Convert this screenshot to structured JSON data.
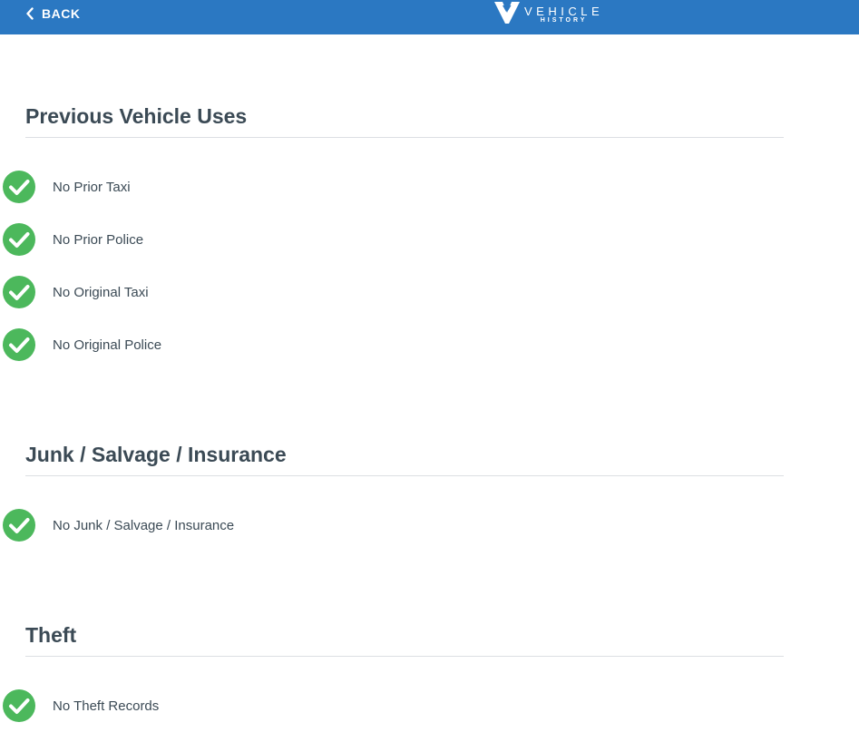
{
  "header": {
    "back_label": "BACK",
    "logo_word": "VEHICLE",
    "logo_sub": "HISTORY",
    "logo_icon": "vehicle-history-logo-icon",
    "back_icon": "chevron-left-icon"
  },
  "colors": {
    "header_bg": "#2b78c2",
    "check_green": "#4cb85c",
    "text": "#3b4a55",
    "rule": "#dcdfe3"
  },
  "sections": [
    {
      "title": "Previous Vehicle Uses",
      "items": [
        {
          "label": "No Prior Taxi",
          "icon": "check-circle-icon"
        },
        {
          "label": "No Prior Police",
          "icon": "check-circle-icon"
        },
        {
          "label": "No Original Taxi",
          "icon": "check-circle-icon"
        },
        {
          "label": "No Original Police",
          "icon": "check-circle-icon"
        }
      ]
    },
    {
      "title": "Junk / Salvage / Insurance",
      "items": [
        {
          "label": "No Junk / Salvage / Insurance",
          "icon": "check-circle-icon"
        }
      ]
    },
    {
      "title": "Theft",
      "items": [
        {
          "label": "No Theft Records",
          "icon": "check-circle-icon"
        }
      ]
    }
  ]
}
